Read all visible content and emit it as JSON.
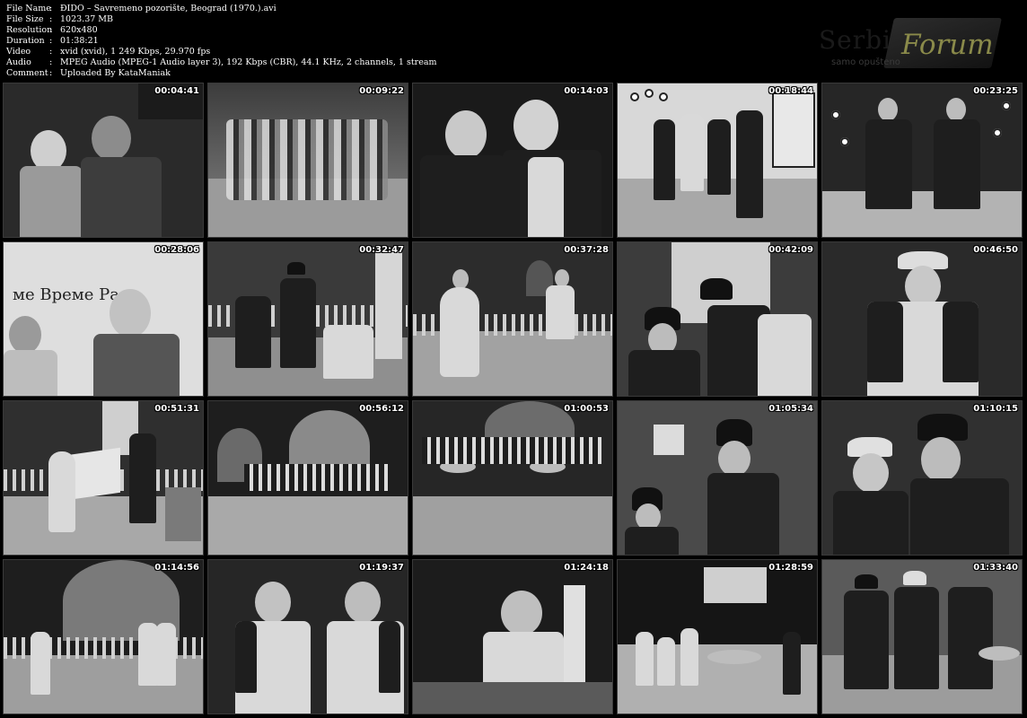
{
  "info": {
    "rows": [
      {
        "label": "File Name",
        "value": "ĐIDO – Savremeno pozorište, Beograd (1970.).avi"
      },
      {
        "label": "File Size",
        "value": "1023.37 MB"
      },
      {
        "label": "Resolution",
        "value": "620x480"
      },
      {
        "label": "Duration",
        "value": "01:38:21"
      },
      {
        "label": "Video",
        "value": "xvid (xvid), 1 249 Kbps, 29.970 fps"
      },
      {
        "label": "Audio",
        "value": "MPEG Audio (MPEG-1 Audio layer 3), 192 Kbps (CBR), 44.1 KHz, 2 channels, 1 stream"
      },
      {
        "label": "Comment",
        "value": "Uploaded By KataManiak"
      }
    ],
    "separator": ":"
  },
  "logo": {
    "word": "Forum",
    "ghost": "Serbian",
    "tagline": "samo opušteno"
  },
  "thumbnails": [
    {
      "time": "00:04:41"
    },
    {
      "time": "00:09:22"
    },
    {
      "time": "00:14:03"
    },
    {
      "time": "00:18:44"
    },
    {
      "time": "00:23:25"
    },
    {
      "time": "00:28:06",
      "sign": "ме Време Ра"
    },
    {
      "time": "00:32:47"
    },
    {
      "time": "00:37:28"
    },
    {
      "time": "00:42:09"
    },
    {
      "time": "00:46:50"
    },
    {
      "time": "00:51:31"
    },
    {
      "time": "00:56:12"
    },
    {
      "time": "01:00:53"
    },
    {
      "time": "01:05:34"
    },
    {
      "time": "01:10:15"
    },
    {
      "time": "01:14:56"
    },
    {
      "time": "01:19:37"
    },
    {
      "time": "01:24:18"
    },
    {
      "time": "01:28:59"
    },
    {
      "time": "01:33:40"
    }
  ]
}
